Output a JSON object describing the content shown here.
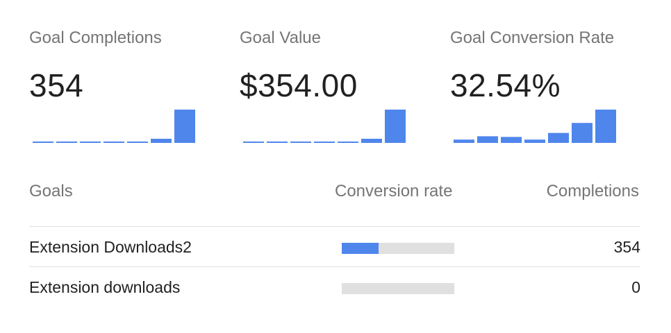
{
  "accent_color": "#4f86ec",
  "track_color": "#e0e0e0",
  "metrics": [
    {
      "title": "Goal Completions",
      "value": "354",
      "sparkline": [
        0,
        0,
        0,
        0,
        0,
        2,
        16
      ]
    },
    {
      "title": "Goal Value",
      "value": "$354.00",
      "sparkline": [
        0,
        0,
        0,
        0,
        0,
        2,
        16
      ]
    },
    {
      "title": "Goal Conversion Rate",
      "value": "32.54%",
      "sparkline": [
        1.5,
        3,
        2.7,
        1.5,
        4.5,
        9,
        15
      ]
    }
  ],
  "table": {
    "headers": {
      "goals": "Goals",
      "conversion_rate": "Conversion rate",
      "completions": "Completions"
    },
    "rows": [
      {
        "name": "Extension Downloads2",
        "rate_fraction": 0.33,
        "completions": "354"
      },
      {
        "name": "Extension downloads",
        "rate_fraction": 0,
        "completions": "0"
      }
    ]
  }
}
